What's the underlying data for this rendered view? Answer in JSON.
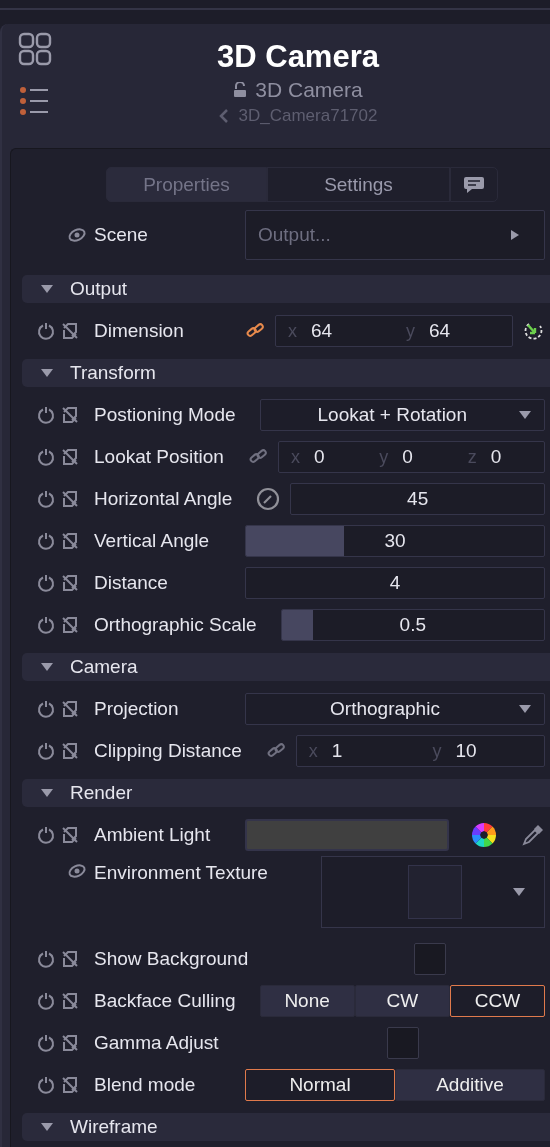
{
  "header": {
    "title": "3D Camera",
    "subtitle": "3D Camera",
    "node_name": "3D_Camera71702"
  },
  "tabs": [
    {
      "label": "Properties",
      "selected": true
    },
    {
      "label": "Settings",
      "selected": false
    }
  ],
  "inputs": [
    {
      "kind": "node-link",
      "label": "Scene",
      "value": "Output..."
    }
  ],
  "sections": [
    {
      "title": "Output",
      "expanded": true,
      "rows": [
        {
          "kind": "vector",
          "label": "Dimension",
          "animatable": true,
          "linked": true,
          "apply_button": true,
          "axes": [
            {
              "axis": "x",
              "value": "64"
            },
            {
              "axis": "y",
              "value": "64"
            }
          ]
        }
      ]
    },
    {
      "title": "Transform",
      "expanded": true,
      "rows": [
        {
          "kind": "select",
          "label": "Postioning Mode",
          "animatable": true,
          "value": "Lookat + Rotation"
        },
        {
          "kind": "vector",
          "label": "Lookat Position",
          "animatable": true,
          "linked": false,
          "apply_button": false,
          "axes": [
            {
              "axis": "x",
              "value": "0"
            },
            {
              "axis": "y",
              "value": "0"
            },
            {
              "axis": "z",
              "value": "0"
            }
          ]
        },
        {
          "kind": "angle",
          "label": "Horizontal Angle",
          "animatable": true,
          "value": "45"
        },
        {
          "kind": "slider",
          "label": "Vertical Angle",
          "animatable": true,
          "value": "30",
          "level": 0.33
        },
        {
          "kind": "number",
          "label": "Distance",
          "animatable": true,
          "value": "4"
        },
        {
          "kind": "slider",
          "label": "Orthographic Scale",
          "animatable": true,
          "value": "0.5",
          "level": 0.12
        }
      ]
    },
    {
      "title": "Camera",
      "expanded": true,
      "rows": [
        {
          "kind": "select",
          "label": "Projection",
          "animatable": true,
          "value": "Orthographic"
        },
        {
          "kind": "vector",
          "label": "Clipping Distance",
          "animatable": true,
          "linked": false,
          "apply_button": false,
          "axes": [
            {
              "axis": "x",
              "value": "1"
            },
            {
              "axis": "y",
              "value": "10"
            }
          ]
        }
      ]
    },
    {
      "title": "Render",
      "expanded": true,
      "rows": [
        {
          "kind": "color",
          "label": "Ambient Light",
          "animatable": true
        },
        {
          "kind": "texture",
          "label": "Environment Texture",
          "animatable": false
        },
        {
          "kind": "checkbox",
          "label": "Show Background",
          "animatable": true,
          "checked": false
        },
        {
          "kind": "toggle",
          "label": "Backface Culling",
          "animatable": true,
          "options": [
            {
              "label": "None",
              "selected": false
            },
            {
              "label": "CW",
              "selected": false
            },
            {
              "label": "CCW",
              "selected": true
            }
          ]
        },
        {
          "kind": "checkbox",
          "label": "Gamma Adjust",
          "animatable": true,
          "checked": false
        },
        {
          "kind": "toggle",
          "label": "Blend mode",
          "animatable": true,
          "options": [
            {
              "label": "Normal",
              "selected": true
            },
            {
              "label": "Additive",
              "selected": false
            }
          ]
        }
      ]
    },
    {
      "title": "Wireframe",
      "expanded": true
    }
  ]
}
